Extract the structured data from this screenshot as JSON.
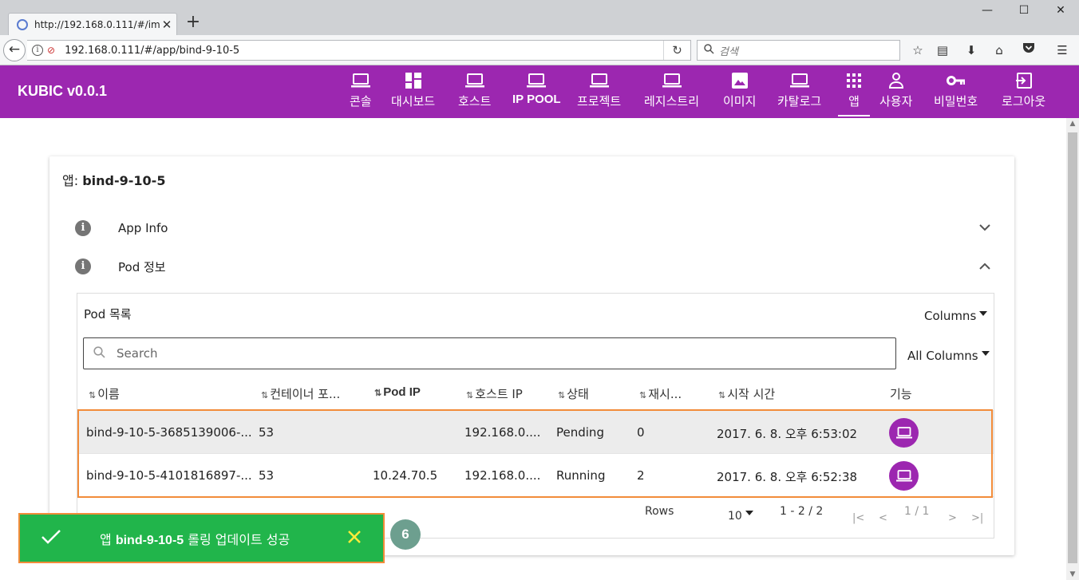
{
  "browser": {
    "tab_title": "http://192.168.0.111/#/imag",
    "tab_close": "✕",
    "new_tab": "+",
    "url": "192.168.0.111/#/app/bind-9-10-5",
    "search_placeholder": "검색"
  },
  "app": {
    "brand": "KUBIC v0.0.1",
    "accent_color": "#9c27b0",
    "menu": [
      {
        "label": "콘솔",
        "icon": "laptop-icon"
      },
      {
        "label": "대시보드",
        "icon": "dashboard-icon"
      },
      {
        "label": "호스트",
        "icon": "laptop-icon"
      },
      {
        "label": "IP POOL",
        "icon": "laptop-icon"
      },
      {
        "label": "프로젝트",
        "icon": "laptop-icon"
      },
      {
        "label": "레지스트리",
        "icon": "laptop-icon"
      },
      {
        "label": "이미지",
        "icon": "image-icon"
      },
      {
        "label": "카탈로그",
        "icon": "laptop-icon"
      },
      {
        "label": "앱",
        "icon": "apps-grid-icon",
        "active": true
      },
      {
        "label": "사용자",
        "icon": "person-icon"
      },
      {
        "label": "비밀번호",
        "icon": "key-icon"
      },
      {
        "label": "로그아웃",
        "icon": "logout-icon"
      }
    ]
  },
  "card": {
    "title_prefix": "앱:",
    "title_name": "bind-9-10-5",
    "panels": {
      "app_info": "App Info",
      "pod_info": "Pod 정보"
    }
  },
  "pods": {
    "title": "Pod 목록",
    "columns_label": "Columns",
    "filter_label": "All Columns",
    "search_placeholder": "Search",
    "headers": [
      "이름",
      "컨테이너 포...",
      "Pod IP",
      "호스트 IP",
      "상태",
      "재시...",
      "시작 시간",
      "기능"
    ],
    "rows": [
      {
        "name": "bind-9-10-5-3685139006-...",
        "port": "53",
        "pod_ip": "",
        "host_ip": "192.168.0....",
        "status": "Pending",
        "restarts": "0",
        "start": "2017. 6. 8. 오후 6:53:02"
      },
      {
        "name": "bind-9-10-5-4101816897-...",
        "port": "53",
        "pod_ip": "10.24.70.5",
        "host_ip": "192.168.0....",
        "status": "Running",
        "restarts": "2",
        "start": "2017. 6. 8. 오후 6:52:38"
      }
    ],
    "footer": {
      "rows_label": "Rows",
      "rows_value": "10",
      "range": "1 - 2 / 2",
      "page": "1 / 1"
    }
  },
  "toast": {
    "prefix": "앱",
    "name": "bind-9-10-5",
    "suffix": "롤링 업데이트 성공",
    "color": "#21b54b"
  },
  "annotation_badge": "6"
}
